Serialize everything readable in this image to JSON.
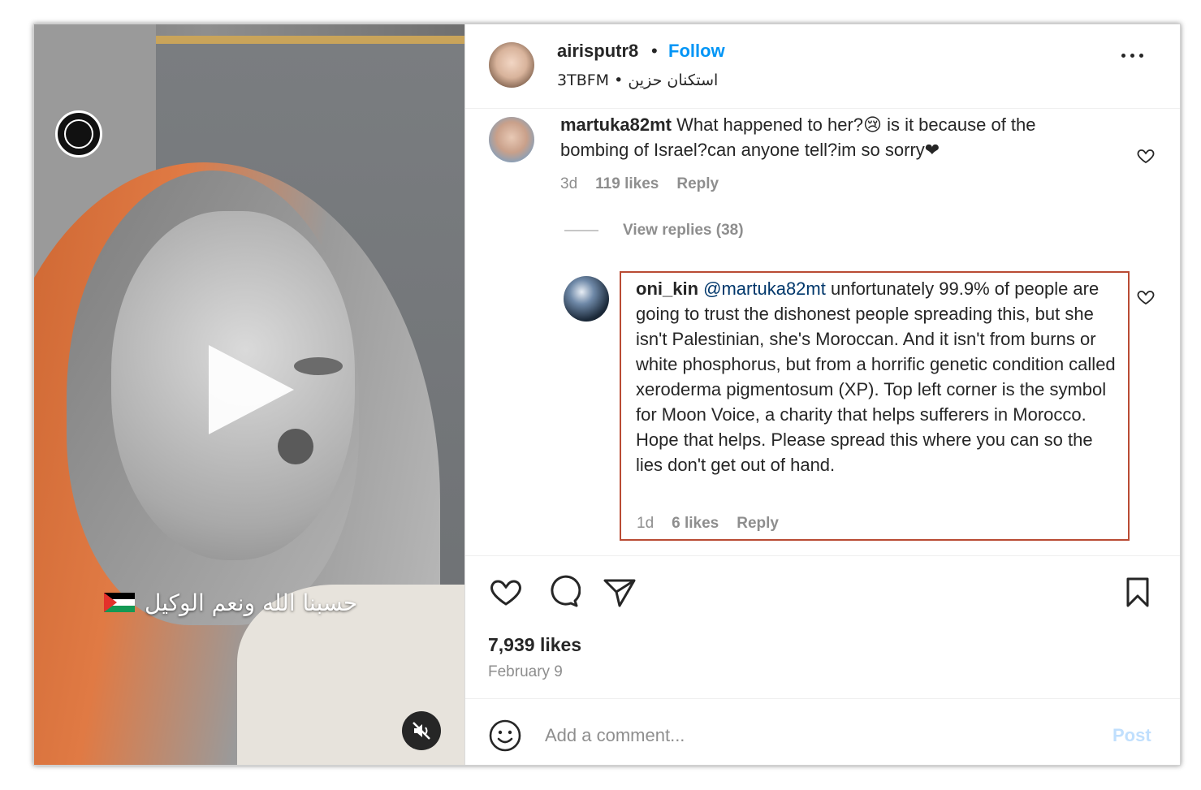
{
  "post": {
    "owner": {
      "username": "airisputr8",
      "separator": "•",
      "follow_label": "Follow",
      "audio_line": "3TBFM • استكنان حزين"
    },
    "media": {
      "overlay_text": "حسبنا الله ونعم الوكيل",
      "logo_icon": "moon-voice-logo-icon",
      "play_icon": "play-icon",
      "mute_icon": "muted-speaker-icon"
    },
    "comments": [
      {
        "username": "martuka82mt",
        "text": "What happened to her?😢 is it because of the bombing of Israel?can anyone tell?im so sorry❤",
        "age": "3d",
        "likes": "119 likes",
        "reply_label": "Reply"
      }
    ],
    "view_replies_label": "View replies (38)",
    "reply": {
      "username": "oni_kin",
      "mention": "@martuka82mt",
      "text": "unfortunately 99.9% of people are going to trust the dishonest people spreading this, but she isn't Palestinian, she's Moroccan. And it isn't from burns or white phosphorus, but from a horrific genetic condition called xeroderma pigmentosum (XP). Top left corner is the symbol for Moon Voice, a charity that helps sufferers in Morocco. Hope that helps. Please spread this where you can so the lies don't get out of hand.",
      "age": "1d",
      "likes": "6 likes",
      "reply_label": "Reply"
    },
    "likes_count": "7,939 likes",
    "date": "February 9",
    "comment_box": {
      "placeholder": "Add a comment...",
      "post_label": "Post"
    }
  },
  "colors": {
    "follow": "#0095f6",
    "highlight_border": "#b94b34",
    "post_disabled": "#c0dffd",
    "secondary_text": "#8e8e8e"
  }
}
